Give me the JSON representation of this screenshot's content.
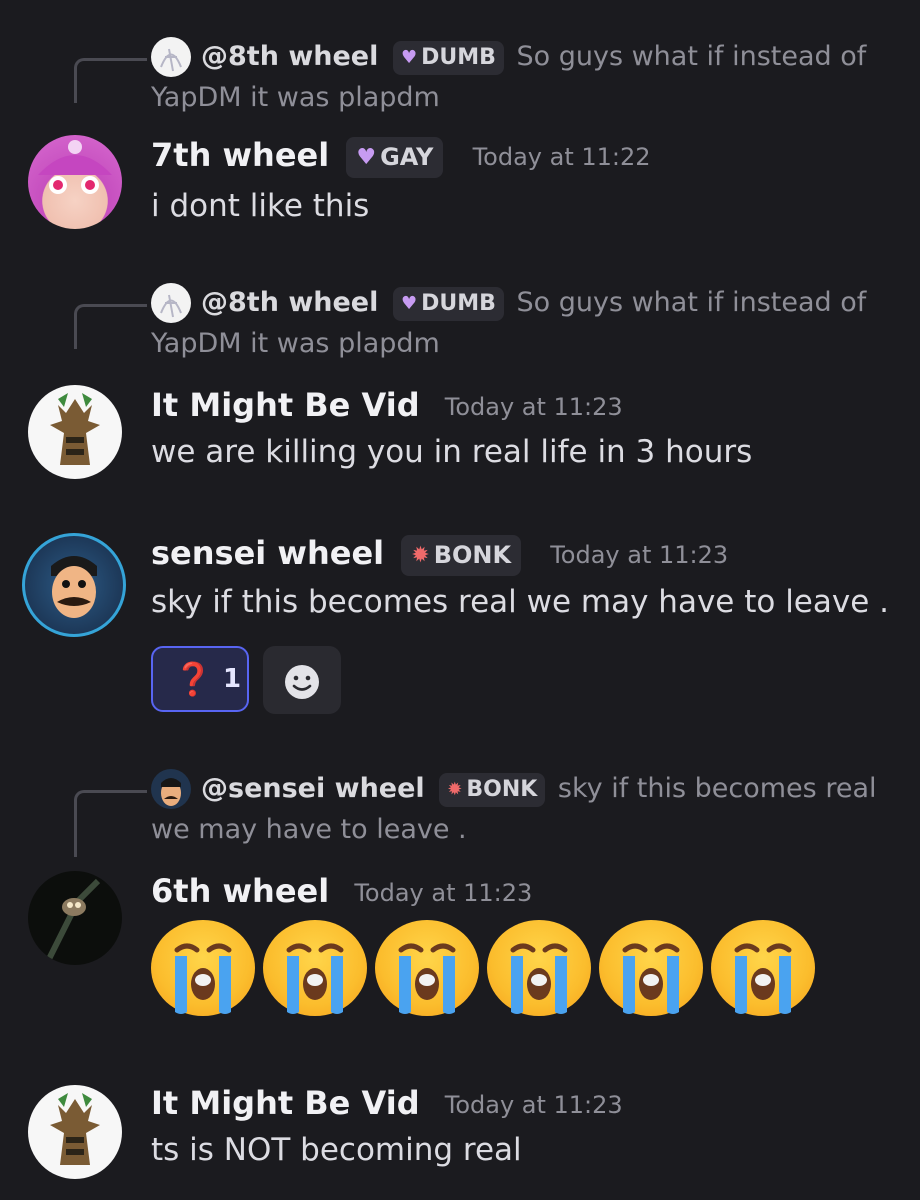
{
  "messages": [
    {
      "reply": {
        "name": "@8th wheel",
        "badge": "DUMB",
        "text_line1": "So guys what if instead of",
        "text_line2": "YapDM it was plapdm"
      },
      "author": "7th wheel",
      "badge": "GAY",
      "time": "Today at 11:22",
      "text": "i dont like this"
    },
    {
      "reply": {
        "name": "@8th wheel",
        "badge": "DUMB",
        "text_line1": "So guys what if instead of",
        "text_line2": "YapDM it was plapdm"
      },
      "author": "It Might Be Vid",
      "time": "Today at 11:23",
      "text": "we are killing you in real life in 3 hours"
    },
    {
      "author": "sensei wheel",
      "badge": "BONK",
      "time": "Today at 11:23",
      "text": "sky if this becomes real we may have to leave .",
      "reaction": {
        "emoji": "❓",
        "count": "1"
      }
    },
    {
      "reply": {
        "name": "@sensei wheel",
        "badge": "BONK",
        "text_line1": "sky if this becomes real",
        "text_line2": "we may have to leave ."
      },
      "author": "6th wheel",
      "time": "Today at 11:23",
      "emoji_count": 6
    },
    {
      "author": "It Might Be Vid",
      "time": "Today at 11:23",
      "text": "ts is NOT becoming real"
    }
  ],
  "icons": {
    "gay_badge": "purple-heart-icon",
    "dumb_badge": "purple-heart-icon",
    "bonk_badge": "bonk-flame-icon",
    "add_reaction": "smiley-face-icon",
    "emoji": "loudly-crying-face-icon"
  },
  "colors": {
    "background": "#1b1b1f",
    "reaction_accent": "#5865f2",
    "badge_bg": "#2c2c33"
  }
}
